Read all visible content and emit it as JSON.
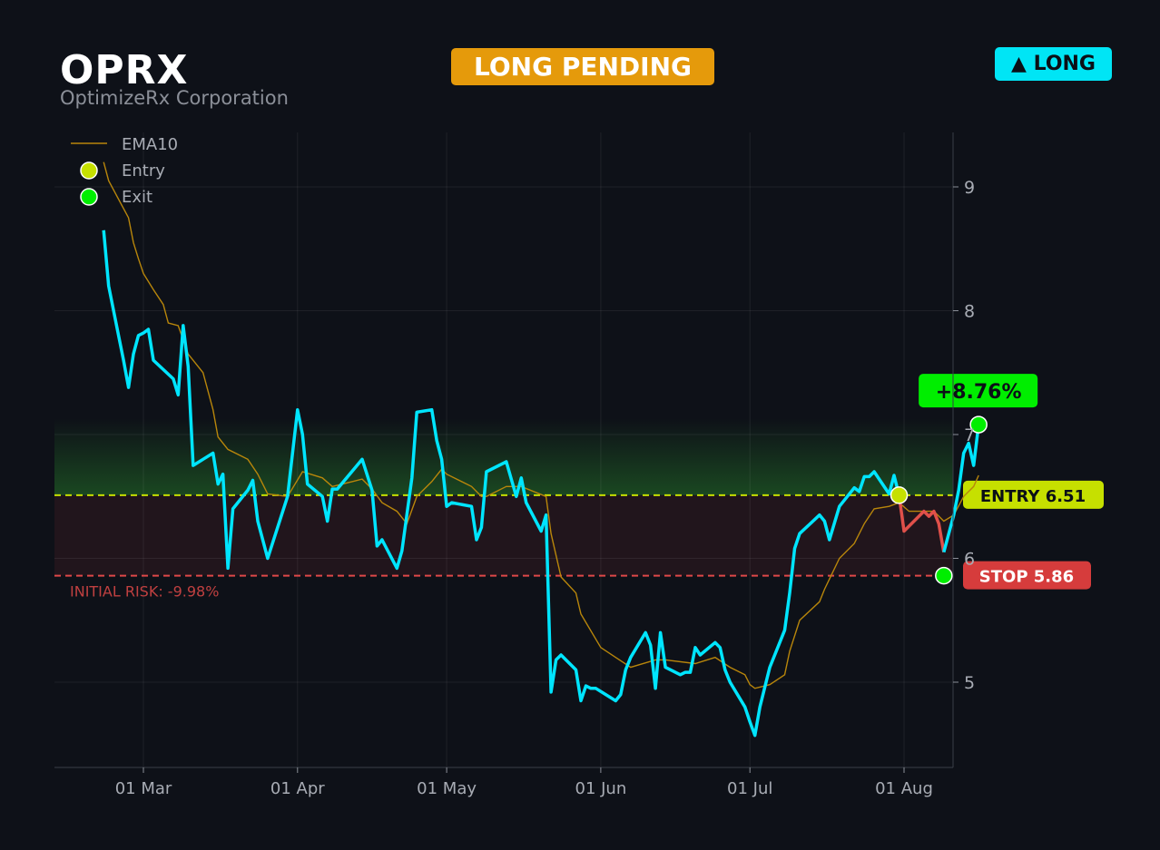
{
  "header": {
    "ticker": "OPRX",
    "company": "OptimizeRx Corporation",
    "status": "LONG PENDING",
    "direction": "▲ LONG"
  },
  "colors": {
    "background": "#0e1118",
    "price": "#00e5ff",
    "ema": "#b8860b",
    "entry": "#c6e000",
    "stop": "#e04848",
    "exit": "#00ee00",
    "loss_segment": "#e0504a",
    "pending": "#e59a0b"
  },
  "chart_data": {
    "type": "line",
    "x_axis": {
      "type": "date",
      "range": [
        "2025-02-12",
        "2025-08-13"
      ],
      "ticks": [
        "01 Mar",
        "01 Apr",
        "01 May",
        "01 Jun",
        "01 Jul",
        "01 Aug"
      ],
      "tick_dates": [
        "2025-03-01",
        "2025-04-01",
        "2025-05-01",
        "2025-06-01",
        "2025-07-01",
        "2025-08-01"
      ]
    },
    "y_axis": {
      "range": [
        4.31,
        9.44
      ],
      "ticks": [
        5,
        6,
        7,
        8,
        9
      ],
      "position": "right"
    },
    "grid": true,
    "legend": {
      "position": "top-left",
      "entries": [
        {
          "label": "EMA10",
          "kind": "line"
        },
        {
          "label": "Entry",
          "kind": "marker"
        },
        {
          "label": "Exit",
          "kind": "marker"
        }
      ]
    },
    "entry_level": {
      "label": "ENTRY 6.51",
      "value": 6.51
    },
    "stop_level": {
      "label": "STOP 5.86",
      "value": 5.86
    },
    "initial_risk_label": "INITIAL RISK: -9.98%",
    "return_label": "+8.76%",
    "price_series": [
      [
        "2025-02-21",
        8.65
      ],
      [
        "2025-02-22",
        8.2
      ],
      [
        "2025-02-24",
        7.8
      ],
      [
        "2025-02-25",
        7.6
      ],
      [
        "2025-02-26",
        7.38
      ],
      [
        "2025-02-27",
        7.65
      ],
      [
        "2025-02-28",
        7.8
      ],
      [
        "2025-03-01",
        7.82
      ],
      [
        "2025-03-02",
        7.85
      ],
      [
        "2025-03-03",
        7.6
      ],
      [
        "2025-03-07",
        7.45
      ],
      [
        "2025-03-08",
        7.32
      ],
      [
        "2025-03-09",
        7.88
      ],
      [
        "2025-03-10",
        7.55
      ],
      [
        "2025-03-11",
        6.75
      ],
      [
        "2025-03-13",
        6.8
      ],
      [
        "2025-03-15",
        6.85
      ],
      [
        "2025-03-16",
        6.6
      ],
      [
        "2025-03-17",
        6.68
      ],
      [
        "2025-03-18",
        5.92
      ],
      [
        "2025-03-19",
        6.4
      ],
      [
        "2025-03-22",
        6.55
      ],
      [
        "2025-03-23",
        6.63
      ],
      [
        "2025-03-24",
        6.3
      ],
      [
        "2025-03-26",
        6.0
      ],
      [
        "2025-03-30",
        6.5
      ],
      [
        "2025-04-01",
        7.2
      ],
      [
        "2025-04-02",
        7.0
      ],
      [
        "2025-04-03",
        6.6
      ],
      [
        "2025-04-06",
        6.5
      ],
      [
        "2025-04-07",
        6.3
      ],
      [
        "2025-04-08",
        6.56
      ],
      [
        "2025-04-09",
        6.56
      ],
      [
        "2025-04-14",
        6.8
      ],
      [
        "2025-04-16",
        6.55
      ],
      [
        "2025-04-17",
        6.1
      ],
      [
        "2025-04-18",
        6.15
      ],
      [
        "2025-04-21",
        5.92
      ],
      [
        "2025-04-22",
        6.06
      ],
      [
        "2025-04-24",
        6.65
      ],
      [
        "2025-04-25",
        7.18
      ],
      [
        "2025-04-28",
        7.2
      ],
      [
        "2025-04-29",
        6.95
      ],
      [
        "2025-04-30",
        6.8
      ],
      [
        "2025-05-01",
        6.42
      ],
      [
        "2025-05-02",
        6.45
      ],
      [
        "2025-05-06",
        6.42
      ],
      [
        "2025-05-07",
        6.15
      ],
      [
        "2025-05-08",
        6.25
      ],
      [
        "2025-05-09",
        6.7
      ],
      [
        "2025-05-13",
        6.78
      ],
      [
        "2025-05-15",
        6.5
      ],
      [
        "2025-05-16",
        6.65
      ],
      [
        "2025-05-17",
        6.45
      ],
      [
        "2025-05-20",
        6.22
      ],
      [
        "2025-05-21",
        6.35
      ],
      [
        "2025-05-22",
        4.92
      ],
      [
        "2025-05-23",
        5.18
      ],
      [
        "2025-05-24",
        5.22
      ],
      [
        "2025-05-27",
        5.1
      ],
      [
        "2025-05-28",
        4.85
      ],
      [
        "2025-05-29",
        4.97
      ],
      [
        "2025-05-30",
        4.95
      ],
      [
        "2025-05-31",
        4.95
      ],
      [
        "2025-06-04",
        4.85
      ],
      [
        "2025-06-05",
        4.9
      ],
      [
        "2025-06-06",
        5.1
      ],
      [
        "2025-06-07",
        5.2
      ],
      [
        "2025-06-10",
        5.4
      ],
      [
        "2025-06-11",
        5.3
      ],
      [
        "2025-06-12",
        4.95
      ],
      [
        "2025-06-13",
        5.4
      ],
      [
        "2025-06-14",
        5.12
      ],
      [
        "2025-06-17",
        5.06
      ],
      [
        "2025-06-18",
        5.08
      ],
      [
        "2025-06-19",
        5.08
      ],
      [
        "2025-06-20",
        5.28
      ],
      [
        "2025-06-21",
        5.22
      ],
      [
        "2025-06-24",
        5.32
      ],
      [
        "2025-06-25",
        5.28
      ],
      [
        "2025-06-26",
        5.1
      ],
      [
        "2025-06-27",
        5.0
      ],
      [
        "2025-06-30",
        4.8
      ],
      [
        "2025-07-01",
        4.68
      ],
      [
        "2025-07-02",
        4.57
      ],
      [
        "2025-07-03",
        4.8
      ],
      [
        "2025-07-05",
        5.12
      ],
      [
        "2025-07-08",
        5.42
      ],
      [
        "2025-07-09",
        5.72
      ],
      [
        "2025-07-10",
        6.08
      ],
      [
        "2025-07-11",
        6.2
      ],
      [
        "2025-07-15",
        6.35
      ],
      [
        "2025-07-16",
        6.3
      ],
      [
        "2025-07-17",
        6.15
      ],
      [
        "2025-07-19",
        6.42
      ],
      [
        "2025-07-22",
        6.57
      ],
      [
        "2025-07-23",
        6.54
      ],
      [
        "2025-07-24",
        6.66
      ],
      [
        "2025-07-25",
        6.66
      ],
      [
        "2025-07-26",
        6.7
      ],
      [
        "2025-07-29",
        6.52
      ],
      [
        "2025-07-30",
        6.67
      ],
      [
        "2025-07-31",
        6.51
      ]
    ],
    "loss_series": [
      [
        "2025-07-31",
        6.51
      ],
      [
        "2025-08-01",
        6.22
      ],
      [
        "2025-08-05",
        6.38
      ],
      [
        "2025-08-06",
        6.34
      ],
      [
        "2025-08-07",
        6.38
      ],
      [
        "2025-08-08",
        6.28
      ],
      [
        "2025-08-09",
        6.05
      ]
    ],
    "recovery_series": [
      [
        "2025-08-09",
        6.05
      ],
      [
        "2025-08-11",
        6.35
      ],
      [
        "2025-08-12",
        6.55
      ],
      [
        "2025-08-13",
        6.85
      ],
      [
        "2025-08-14",
        6.93
      ],
      [
        "2025-08-15",
        6.75
      ],
      [
        "2025-08-16",
        7.08
      ]
    ],
    "ema_series": [
      [
        "2025-02-21",
        9.2
      ],
      [
        "2025-02-22",
        9.05
      ],
      [
        "2025-02-26",
        8.75
      ],
      [
        "2025-02-27",
        8.55
      ],
      [
        "2025-02-28",
        8.42
      ],
      [
        "2025-03-01",
        8.3
      ],
      [
        "2025-03-03",
        8.17
      ],
      [
        "2025-03-05",
        8.05
      ],
      [
        "2025-03-06",
        7.9
      ],
      [
        "2025-03-08",
        7.88
      ],
      [
        "2025-03-10",
        7.65
      ],
      [
        "2025-03-13",
        7.5
      ],
      [
        "2025-03-15",
        7.2
      ],
      [
        "2025-03-16",
        6.98
      ],
      [
        "2025-03-18",
        6.88
      ],
      [
        "2025-03-22",
        6.8
      ],
      [
        "2025-03-24",
        6.68
      ],
      [
        "2025-03-26",
        6.52
      ],
      [
        "2025-03-30",
        6.5
      ],
      [
        "2025-04-02",
        6.7
      ],
      [
        "2025-04-06",
        6.65
      ],
      [
        "2025-04-08",
        6.58
      ],
      [
        "2025-04-12",
        6.62
      ],
      [
        "2025-04-14",
        6.64
      ],
      [
        "2025-04-16",
        6.56
      ],
      [
        "2025-04-18",
        6.45
      ],
      [
        "2025-04-21",
        6.38
      ],
      [
        "2025-04-23",
        6.28
      ],
      [
        "2025-04-25",
        6.5
      ],
      [
        "2025-04-28",
        6.62
      ],
      [
        "2025-04-30",
        6.72
      ],
      [
        "2025-05-01",
        6.68
      ],
      [
        "2025-05-06",
        6.58
      ],
      [
        "2025-05-08",
        6.5
      ],
      [
        "2025-05-09",
        6.5
      ],
      [
        "2025-05-13",
        6.58
      ],
      [
        "2025-05-16",
        6.58
      ],
      [
        "2025-05-21",
        6.5
      ],
      [
        "2025-05-22",
        6.2
      ],
      [
        "2025-05-24",
        5.85
      ],
      [
        "2025-05-27",
        5.72
      ],
      [
        "2025-05-28",
        5.55
      ],
      [
        "2025-06-01",
        5.28
      ],
      [
        "2025-06-04",
        5.2
      ],
      [
        "2025-06-07",
        5.12
      ],
      [
        "2025-06-12",
        5.18
      ],
      [
        "2025-06-14",
        5.18
      ],
      [
        "2025-06-20",
        5.15
      ],
      [
        "2025-06-24",
        5.2
      ],
      [
        "2025-06-27",
        5.12
      ],
      [
        "2025-06-30",
        5.06
      ],
      [
        "2025-07-01",
        4.98
      ],
      [
        "2025-07-02",
        4.95
      ],
      [
        "2025-07-05",
        4.98
      ],
      [
        "2025-07-08",
        5.06
      ],
      [
        "2025-07-09",
        5.25
      ],
      [
        "2025-07-11",
        5.5
      ],
      [
        "2025-07-15",
        5.65
      ],
      [
        "2025-07-16",
        5.75
      ],
      [
        "2025-07-19",
        6.0
      ],
      [
        "2025-07-22",
        6.12
      ],
      [
        "2025-07-24",
        6.28
      ],
      [
        "2025-07-26",
        6.4
      ],
      [
        "2025-07-29",
        6.42
      ],
      [
        "2025-07-31",
        6.45
      ],
      [
        "2025-08-02",
        6.38
      ],
      [
        "2025-08-07",
        6.38
      ],
      [
        "2025-08-09",
        6.3
      ],
      [
        "2025-08-11",
        6.35
      ],
      [
        "2025-08-13",
        6.5
      ],
      [
        "2025-08-15",
        6.58
      ],
      [
        "2025-08-16",
        6.67
      ]
    ],
    "markers": [
      {
        "kind": "Entry",
        "date": "2025-07-31",
        "value": 6.51
      },
      {
        "kind": "Exit",
        "date": "2025-08-09",
        "value": 5.86
      },
      {
        "kind": "Exit",
        "date": "2025-08-16",
        "value": 7.08
      }
    ],
    "zones": [
      {
        "kind": "profit",
        "from": 6.51,
        "to": 7.13
      },
      {
        "kind": "risk",
        "from": 5.86,
        "to": 6.51
      }
    ]
  }
}
